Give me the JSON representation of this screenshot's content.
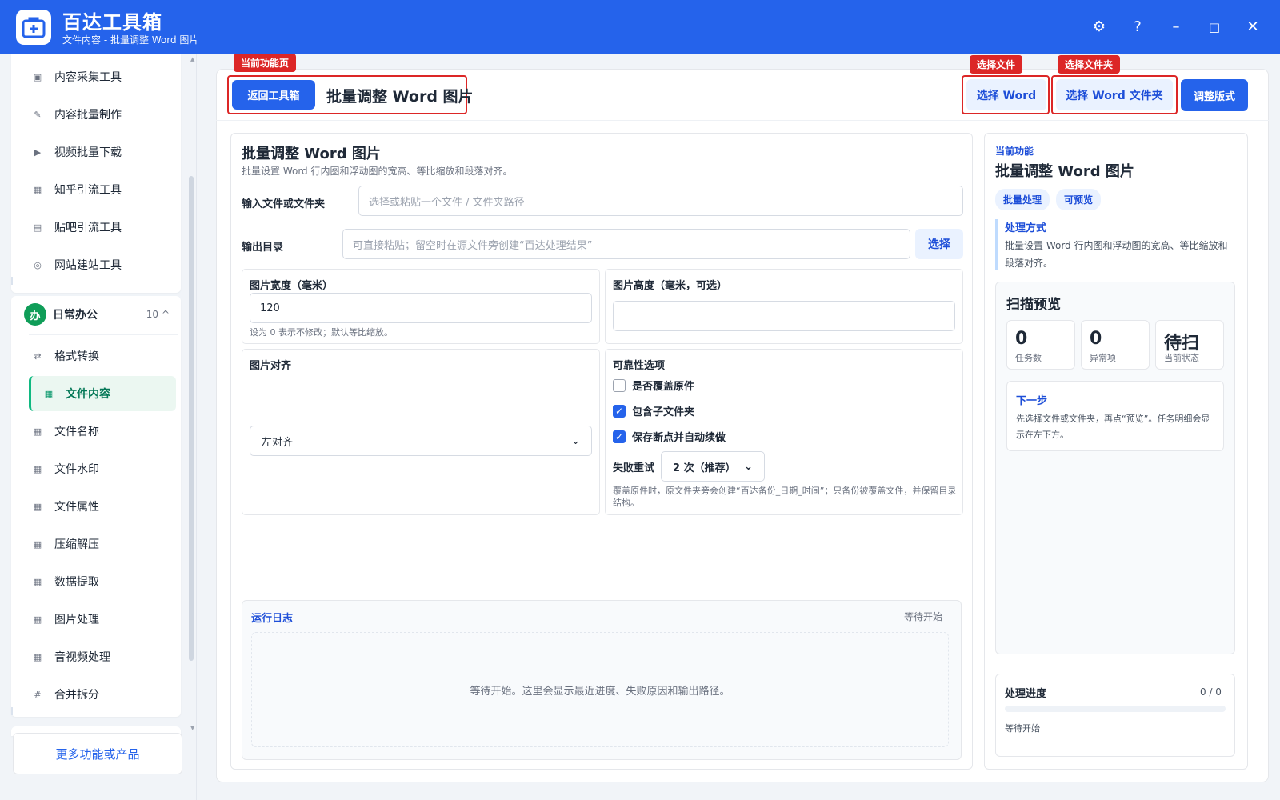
{
  "app": {
    "name": "百达工具箱",
    "subtitle": "文件内容 - 批量调整 Word 图片"
  },
  "window_controls": {
    "settings": "⚙",
    "help": "?",
    "minimize": "–",
    "maximize": "□",
    "close": "✕"
  },
  "sidebar": {
    "group1_items": [
      {
        "label": "内容采集工具",
        "icon": "▣"
      },
      {
        "label": "内容批量制作",
        "icon": "✎"
      },
      {
        "label": "视频批量下载",
        "icon": "▶"
      },
      {
        "label": "知乎引流工具",
        "icon": "▦"
      },
      {
        "label": "贴吧引流工具",
        "icon": "▤"
      },
      {
        "label": "网站建站工具",
        "icon": "◎"
      }
    ],
    "group2": {
      "badge": "办",
      "title": "日常办公",
      "count": "10",
      "caret": "^",
      "items": [
        {
          "label": "格式转换",
          "icon": "⇄"
        },
        {
          "label": "文件内容",
          "icon": "▦"
        },
        {
          "label": "文件名称",
          "icon": "▦"
        },
        {
          "label": "文件水印",
          "icon": "▦"
        },
        {
          "label": "文件属性",
          "icon": "▦"
        },
        {
          "label": "压缩解压",
          "icon": "▦"
        },
        {
          "label": "数据提取",
          "icon": "▦"
        },
        {
          "label": "图片处理",
          "icon": "▦"
        },
        {
          "label": "音视频处理",
          "icon": "▦"
        },
        {
          "label": "合并拆分",
          "icon": "#"
        }
      ]
    },
    "more_button": "更多功能或产品"
  },
  "annotations": {
    "current_page": "当前功能页",
    "select_file": "选择文件",
    "select_folder": "选择文件夹"
  },
  "toolbar": {
    "back_button": "返回工具箱",
    "page_title": "批量调整 Word 图片",
    "select_word": "选择 Word",
    "select_word_folder": "选择 Word 文件夹",
    "adjust_layout": "调整版式"
  },
  "form": {
    "title": "批量调整 Word 图片",
    "description": "批量设置 Word 行内图和浮动图的宽高、等比缩放和段落对齐。",
    "input_label": "输入文件或文件夹",
    "input_placeholder": "选择或粘贴一个文件 / 文件夹路径",
    "output_label": "输出目录",
    "output_placeholder": "可直接粘贴；留空时在源文件旁创建“百达处理结果”",
    "output_select": "选择",
    "width_label": "图片宽度（毫米）",
    "width_value": "120",
    "width_hint": "设为 0 表示不修改；默认等比缩放。",
    "height_label": "图片高度（毫米，可选）",
    "height_value": "",
    "align_label": "图片对齐",
    "align_value": "左对齐",
    "reliability_label": "可靠性选项",
    "opt_overwrite": "是否覆盖原件",
    "opt_overwrite_checked": false,
    "opt_subfolders": "包含子文件夹",
    "opt_subfolders_checked": true,
    "opt_resume": "保存断点并自动续做",
    "opt_resume_checked": true,
    "retry_label": "失败重试",
    "retry_value": "2 次（推荐）",
    "reliability_hint": "覆盖原件时，原文件夹旁会创建“百达备份_日期_时间”；只备份被覆盖文件，并保留目录结构。"
  },
  "log": {
    "title": "运行日志",
    "status": "等待开始",
    "empty": "等待开始。这里会显示最近进度、失败原因和输出路径。"
  },
  "right_panel": {
    "section_label": "当前功能",
    "title": "批量调整 Word 图片",
    "chips": [
      "批量处理",
      "可预览"
    ],
    "method_title": "处理方式",
    "method_desc": "批量设置 Word 行内图和浮动图的宽高、等比缩放和段落对齐。",
    "scan_title": "扫描预览",
    "stats": [
      {
        "value": "0",
        "label": "任务数"
      },
      {
        "value": "0",
        "label": "异常项"
      },
      {
        "value": "待扫",
        "label": "当前状态"
      }
    ],
    "next_title": "下一步",
    "next_desc": "先选择文件或文件夹，再点“预览”。任务明细会显示在左下方。",
    "progress_title": "处理进度",
    "progress_count": "0 / 0",
    "progress_fraction": 0,
    "progress_status": "等待开始"
  },
  "colors": {
    "primary": "#2563eb",
    "accent_green": "#10b981",
    "annotation_red": "#dc2626"
  }
}
